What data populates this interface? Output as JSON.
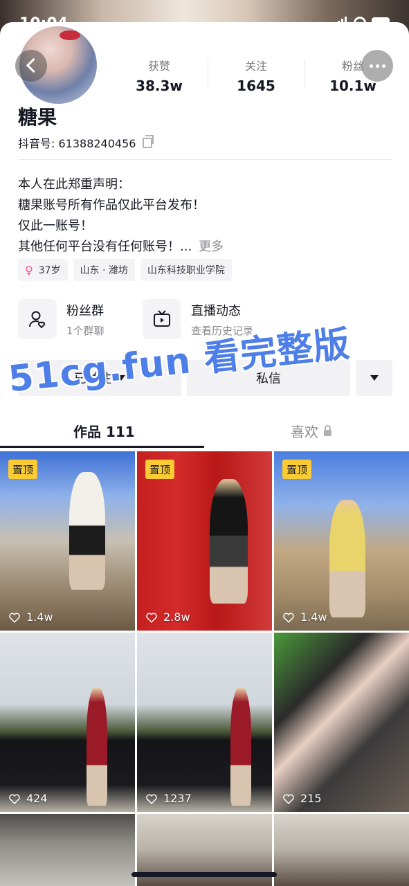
{
  "status_bar": {
    "time": "10:04"
  },
  "profile": {
    "name": "糖果",
    "douyin_id_label": "抖音号: 61388240456",
    "stats": [
      {
        "label": "获赞",
        "value": "38.3w"
      },
      {
        "label": "关注",
        "value": "1645"
      },
      {
        "label": "粉丝",
        "value": "10.1w"
      }
    ],
    "bio_lines": [
      "本人在此郑重声明：",
      "糖果账号所有作品仅此平台发布！",
      "仅此一账号！",
      "其他任何平台没有任何账号！..."
    ],
    "bio_more": "更多",
    "tags": {
      "age": "37岁",
      "location": "山东 · 潍坊",
      "school": "山东科技职业学院"
    }
  },
  "entries": {
    "fan_group": {
      "title": "粉丝群",
      "sub": "1个群聊"
    },
    "live": {
      "title": "直播动态",
      "sub": "查看历史记录"
    }
  },
  "actions": {
    "followed": "已关注",
    "message": "私信"
  },
  "watermark": "51cg.fun 看完整版",
  "tabs": {
    "works": "作品 111",
    "likes": "喜欢"
  },
  "videos": [
    {
      "pinned": "置顶",
      "likes": "1.4w"
    },
    {
      "pinned": "置顶",
      "likes": "2.8w"
    },
    {
      "pinned": "置顶",
      "likes": "1.4w"
    },
    {
      "likes": "424"
    },
    {
      "likes": "1237"
    },
    {
      "likes": "215"
    }
  ],
  "colors": {
    "pin_badge": "#facb33",
    "watermark": "#4e7fe8",
    "gender_icon": "#ff4d88"
  }
}
